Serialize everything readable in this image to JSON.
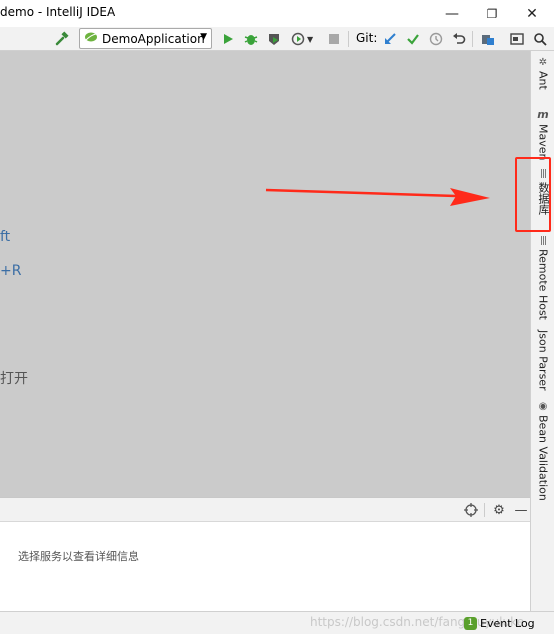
{
  "window": {
    "title": "demo - IntelliJ IDEA",
    "minimize_glyph": "—",
    "restore_glyph": "❐",
    "close_glyph": "✕"
  },
  "toolbar": {
    "build_icon": "hammer-icon",
    "run_config": {
      "label": "DemoApplication",
      "icon": "spring-leaf-icon"
    },
    "icons": [
      "run-icon",
      "debug-icon",
      "coverage-icon",
      "profile-icon",
      "stop-icon"
    ],
    "git_label": "Git:",
    "git_icons": [
      "update-project-icon",
      "commit-icon",
      "history-icon",
      "rollback-icon"
    ],
    "right_icons": [
      "project-structure-icon",
      "presentation-icon",
      "search-icon"
    ]
  },
  "editor": {
    "hints": [
      {
        "text": "ft",
        "style": "link"
      },
      {
        "text": "+R",
        "style": "link"
      },
      {
        "text": "打开",
        "style": "gray"
      }
    ]
  },
  "right_stripe": {
    "items": [
      {
        "label": "Ant",
        "icon": "ant-icon"
      },
      {
        "label": "Maven",
        "icon": "maven-icon"
      },
      {
        "label": "数据库",
        "icon": "database-icon"
      },
      {
        "label": "Remote Host",
        "icon": "remote-host-icon"
      },
      {
        "label": "Json Parser",
        "icon": ""
      },
      {
        "label": "Bean Validation",
        "icon": "bean-validation-icon"
      }
    ]
  },
  "services": {
    "empty_message": "选择服务以查看详细信息",
    "header_icons": [
      "target-icon",
      "gear-icon",
      "minimize-icon"
    ]
  },
  "statusbar": {
    "watermark": "https://blog.csdn.net/fangmuyuluke",
    "event_log_label": "Event Log",
    "event_log_badge": "1"
  },
  "annotation": {
    "color": "#ff2a1a"
  }
}
